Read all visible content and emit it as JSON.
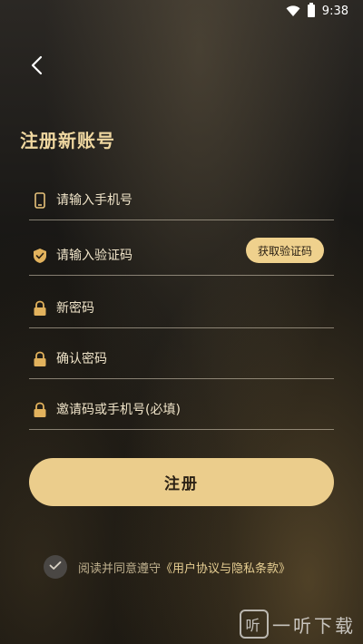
{
  "status_bar": {
    "time": "9:38",
    "wifi_icon": "wifi-icon",
    "battery_icon": "battery-icon"
  },
  "header": {
    "back_icon": "back-chevron-icon",
    "title": "注册新账号"
  },
  "form": {
    "phone": {
      "icon": "phone-icon",
      "placeholder": "请输入手机号",
      "value": ""
    },
    "verification": {
      "icon": "shield-check-icon",
      "placeholder": "请输入验证码",
      "value": "",
      "get_code_label": "获取验证码"
    },
    "new_password": {
      "icon": "lock-icon",
      "placeholder": "新密码",
      "value": ""
    },
    "confirm_password": {
      "icon": "lock-icon",
      "placeholder": "确认密码",
      "value": ""
    },
    "invite_code": {
      "icon": "lock-icon",
      "placeholder": "邀请码或手机号(必填)",
      "value": ""
    }
  },
  "register_button": {
    "label": "注册"
  },
  "agreement": {
    "checked": true,
    "prefix": "阅读并同意遵守",
    "link_text": "《用户协议与隐私条款》"
  },
  "watermark": {
    "mark": "听",
    "text": "一听下载"
  },
  "colors": {
    "accent_gold": "#ebcd8c",
    "title_gold": "#efd7a0",
    "background_dark": "#151412"
  }
}
